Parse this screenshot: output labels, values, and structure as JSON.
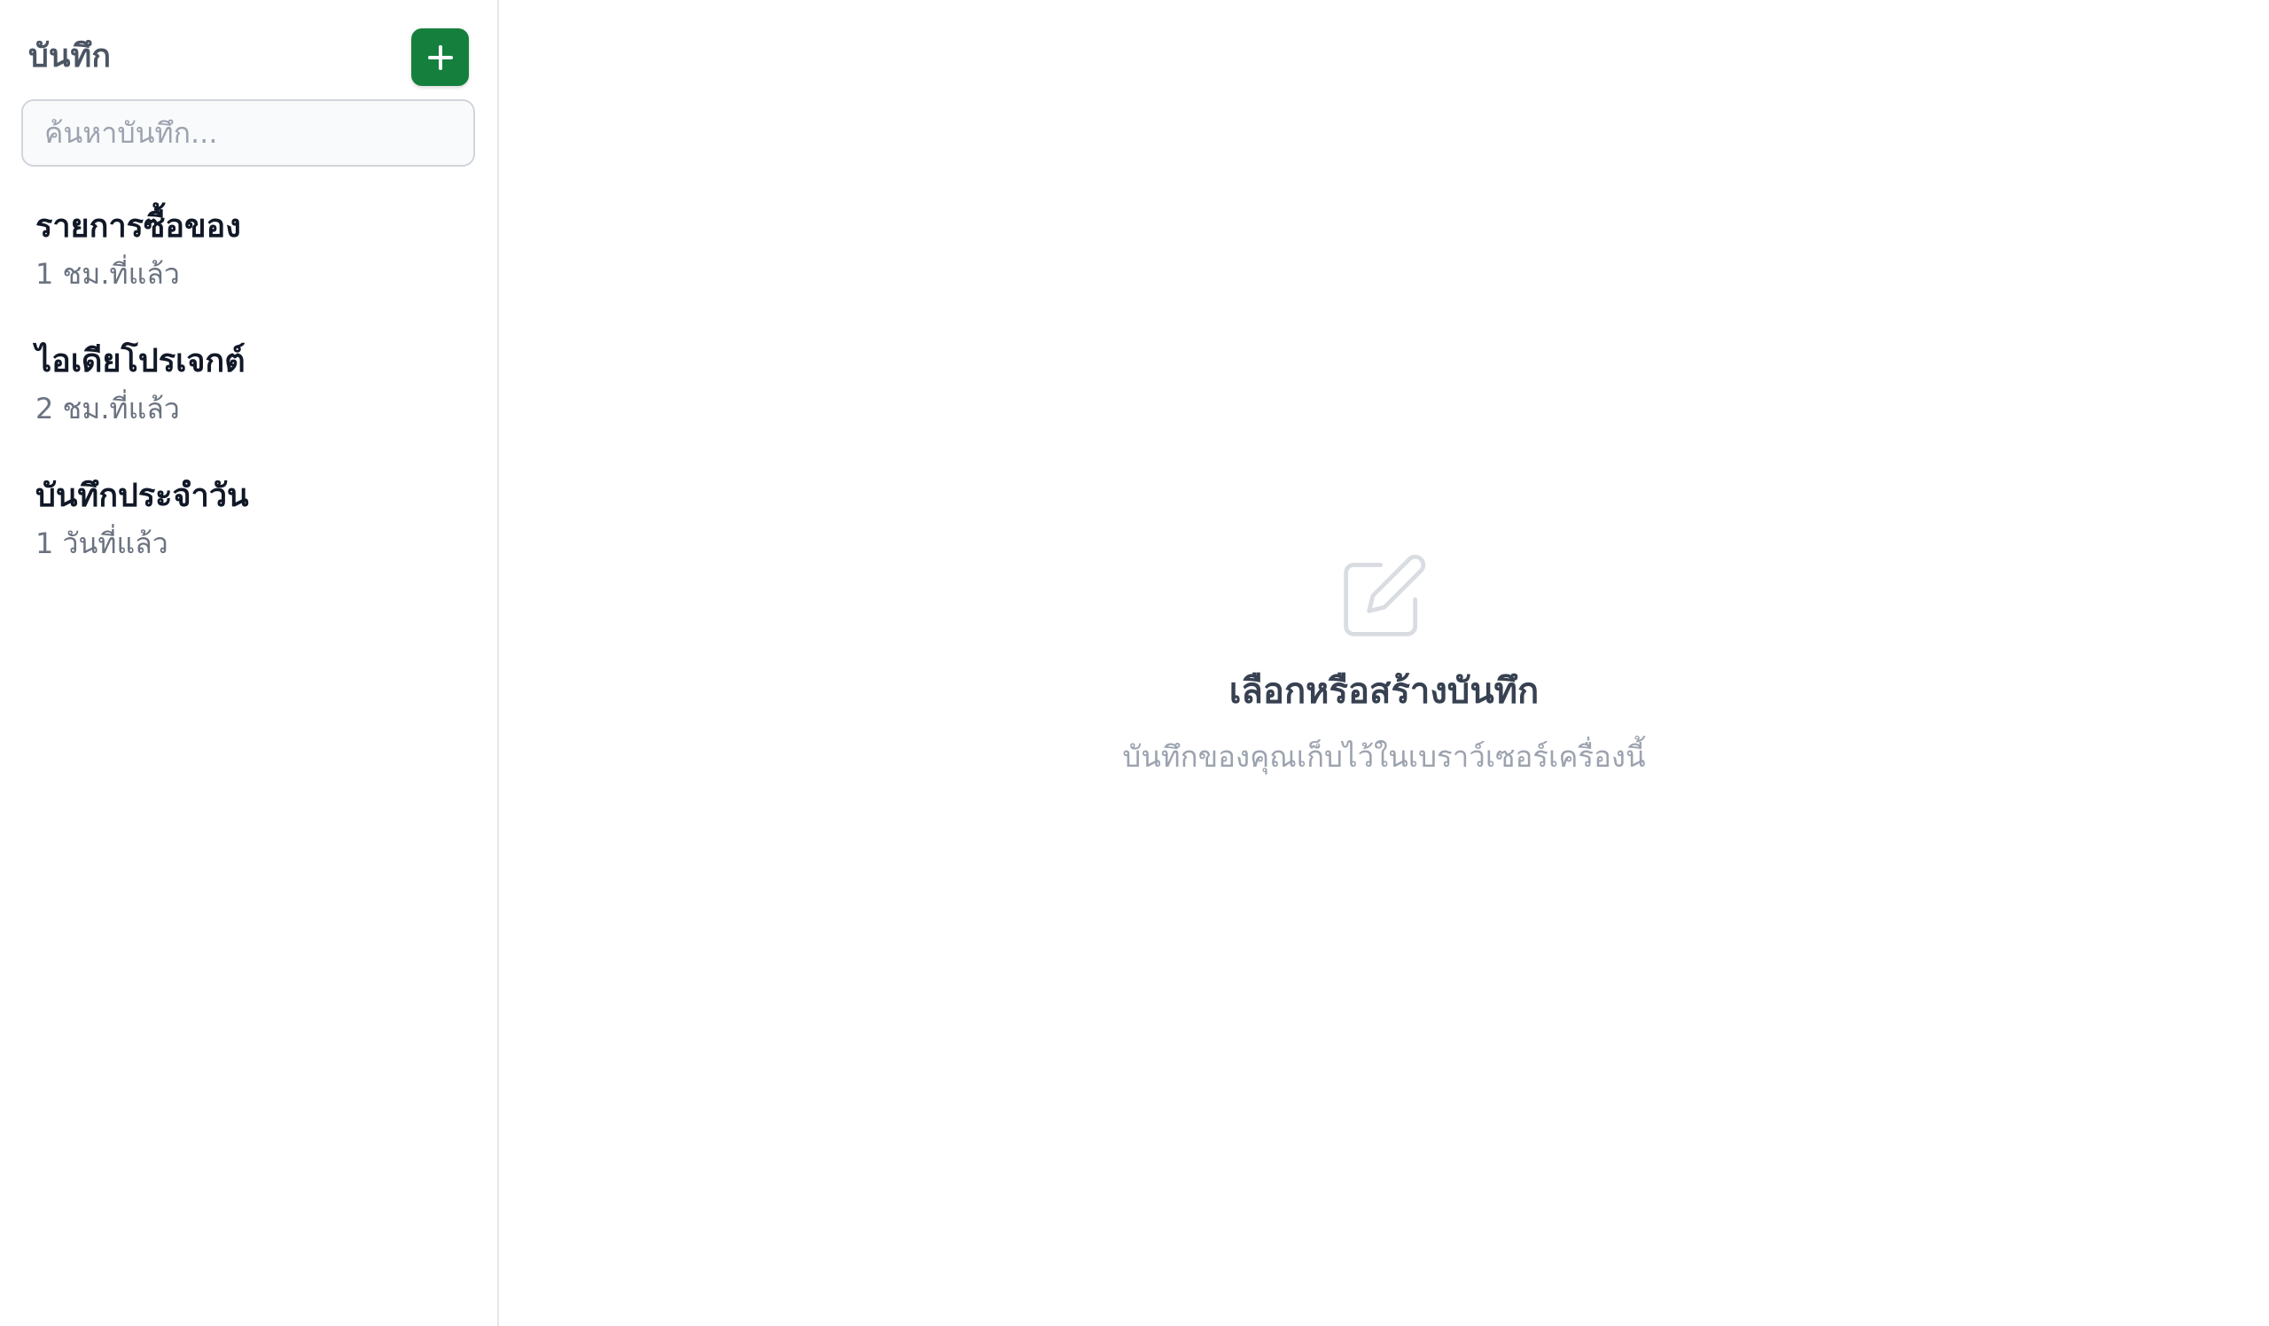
{
  "sidebar": {
    "title": "บันทึก",
    "add_button": {
      "icon": "plus-icon",
      "color": "#15803d"
    },
    "search": {
      "placeholder": "ค้นหาบันทึก...",
      "value": ""
    },
    "notes": [
      {
        "title": "รายการซื้อของ",
        "time": "1 ชม.ที่แล้ว"
      },
      {
        "title": "ไอเดียโปรเจกต์",
        "time": "2 ชม.ที่แล้ว"
      },
      {
        "title": "บันทึกประจำวัน",
        "time": "1 วันที่แล้ว"
      }
    ]
  },
  "main": {
    "empty_state": {
      "icon": "edit-note-icon",
      "title": "เลือกหรือสร้างบันทึก",
      "subtitle": "บันทึกของคุณเก็บไว้ในเบราว์เซอร์เครื่องนี้"
    }
  }
}
